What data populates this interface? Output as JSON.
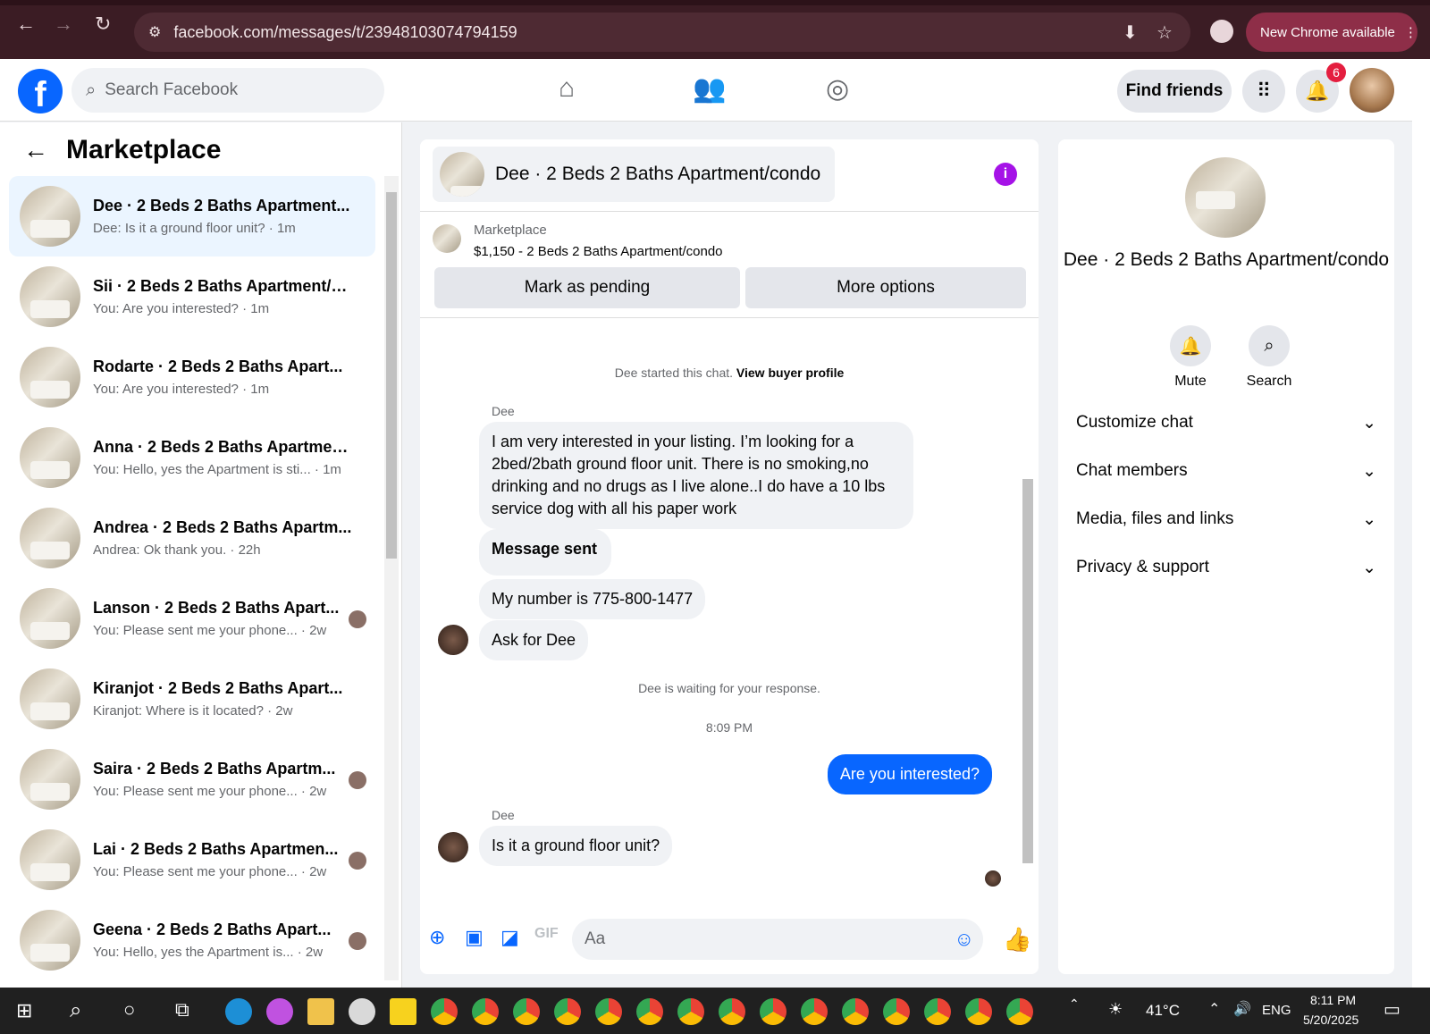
{
  "browser": {
    "url": "facebook.com/messages/t/23948103074794159",
    "new_chrome": "New Chrome available"
  },
  "facebook": {
    "search_placeholder": "Search Facebook",
    "find_friends": "Find friends",
    "notif_count": "6"
  },
  "left": {
    "title": "Marketplace",
    "conversations": [
      {
        "name": "Dee · 2 Beds 2 Baths Apartment...",
        "preview": "Dee: Is it a ground floor unit? · 1m"
      },
      {
        "name": "Sii · 2 Beds 2 Baths Apartment/c...",
        "preview": "You: Are you interested? · 1m"
      },
      {
        "name": "Rodarte · 2 Beds 2 Baths Apart...",
        "preview": "You: Are you interested? · 1m"
      },
      {
        "name": "Anna · 2 Beds 2 Baths Apartmen...",
        "preview": "You: Hello, yes the Apartment is sti... · 1m"
      },
      {
        "name": "Andrea · 2 Beds 2 Baths Apartm...",
        "preview": "Andrea: Ok thank you. · 22h"
      },
      {
        "name": "Lanson · 2 Beds 2 Baths Apart...",
        "preview": "You: Please sent me your phone... · 2w"
      },
      {
        "name": "Kiranjot · 2 Beds 2 Baths Apart...",
        "preview": "Kiranjot: Where is it located? · 2w"
      },
      {
        "name": "Saira · 2 Beds 2 Baths Apartm...",
        "preview": "You: Please sent me your phone... · 2w"
      },
      {
        "name": "Lai · 2 Beds 2 Baths Apartmen...",
        "preview": "You: Please sent me your phone... · 2w"
      },
      {
        "name": "Geena · 2 Beds 2 Baths Apart...",
        "preview": "You: Hello, yes the Apartment is... · 2w"
      }
    ]
  },
  "chat": {
    "title": "Dee · 2 Beds 2 Baths Apartment/condo",
    "listing_label": "Marketplace",
    "listing_detail": "$1,150 - 2 Beds 2 Baths Apartment/condo",
    "btn_pending": "Mark as pending",
    "btn_more": "More options",
    "started": "Dee started this chat.",
    "view_profile": "View buyer profile",
    "sender": "Dee",
    "m1": "I am very interested in your listing.  I’m looking for a 2bed/2bath ground floor unit. There is no smoking,no drinking and no drugs as I live alone..I do have a 10 lbs service dog with all his paper work",
    "m2": "Message sent",
    "m3": "My number is 775-800-1477",
    "m4": "Ask for Dee",
    "waiting": "Dee is waiting for your response.",
    "time": "8:09 PM",
    "m5": "Are you interested?",
    "m6": "Is it a ground floor unit?",
    "input_placeholder": "Aa"
  },
  "right": {
    "name": "Dee · 2 Beds 2 Baths Apartment/condo",
    "mute": "Mute",
    "search": "Search",
    "sections": [
      "Customize chat",
      "Chat members",
      "Media, files and links",
      "Privacy & support"
    ]
  },
  "taskbar": {
    "temp": "41°C",
    "lang": "ENG",
    "time": "8:11 PM",
    "date": "5/20/2025"
  }
}
